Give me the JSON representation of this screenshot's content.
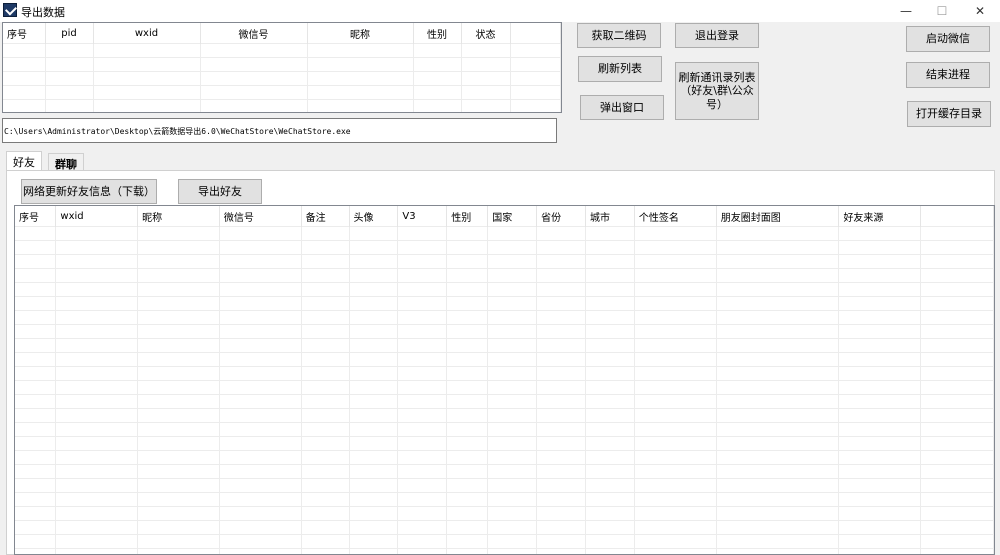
{
  "window": {
    "title": "导出数据",
    "minimize": "—",
    "maximize": "☐",
    "close": "✕"
  },
  "top_table": {
    "columns": [
      "序号",
      "pid",
      "wxid",
      "微信号",
      "昵称",
      "性别",
      "状态",
      ""
    ]
  },
  "buttons": {
    "get_qrcode": "获取二维码",
    "logout": "退出登录",
    "launch_wechat": "启动微信",
    "refresh_list": "刷新列表",
    "end_process": "结束进程",
    "popup_window": "弹出窗口",
    "refresh_contacts": "刷新通讯录列表（好友\\群\\公众号）",
    "open_cache_dir": "打开缓存目录",
    "network_update": "网络更新好友信息（下载）",
    "export_friends": "导出好友"
  },
  "path": "C:\\Users\\Administrator\\Desktop\\云箭数据导出6.0\\WeChatStore\\WeChatStore.exe",
  "tabs": {
    "friends": "好友",
    "groups": "群聊"
  },
  "friends_table": {
    "columns": [
      "序号",
      "wxid",
      "昵称",
      "微信号",
      "备注",
      "头像",
      "V3",
      "性别",
      "国家",
      "省份",
      "城市",
      "个性签名",
      "朋友圈封面图",
      "好友来源",
      ""
    ]
  }
}
